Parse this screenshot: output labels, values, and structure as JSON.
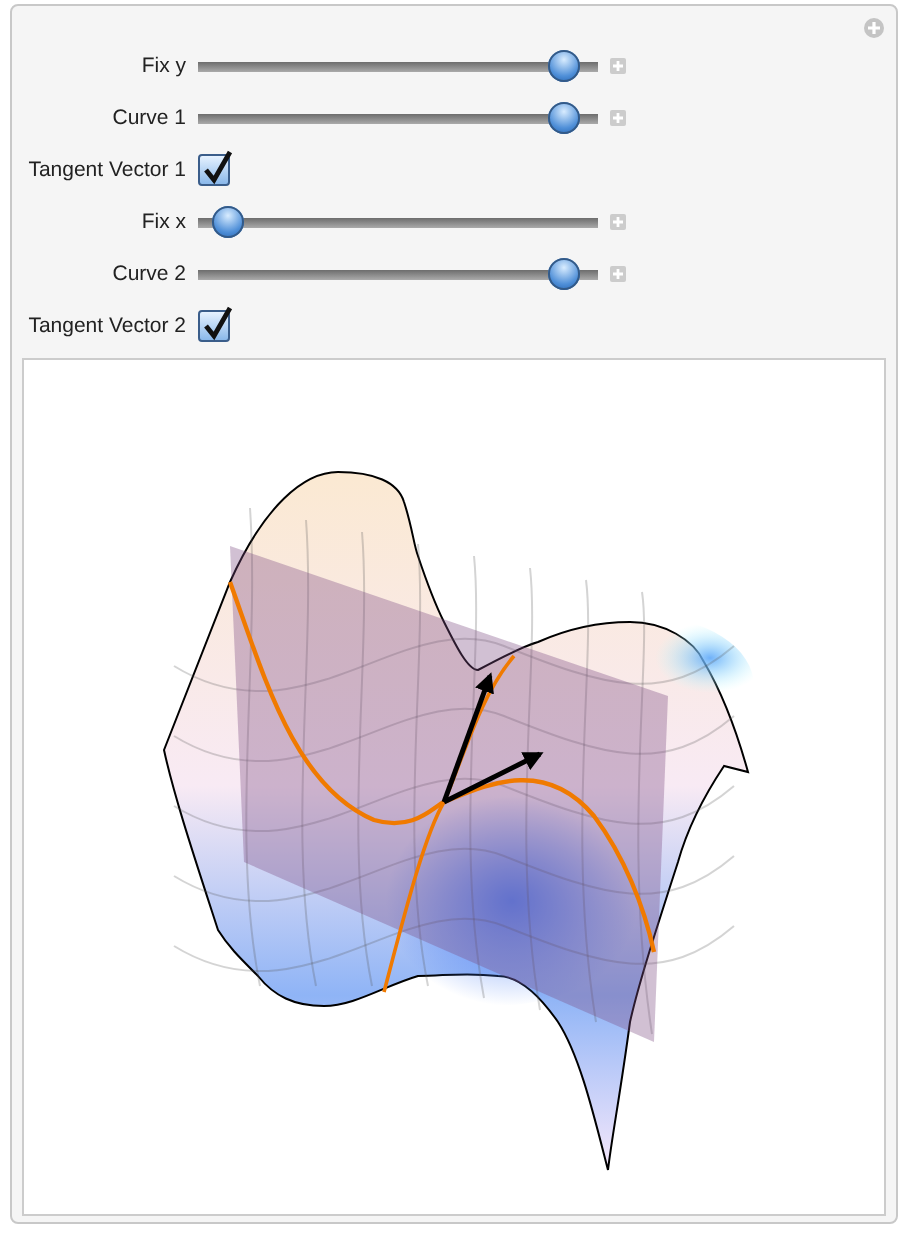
{
  "controls": [
    {
      "kind": "slider",
      "label": "Fix y",
      "level": 0.95
    },
    {
      "kind": "slider",
      "label": "Curve 1",
      "level": 0.95
    },
    {
      "kind": "checkbox",
      "label": "Tangent Vector 1",
      "checked": true
    },
    {
      "kind": "slider",
      "label": "Fix x",
      "level": 0.04
    },
    {
      "kind": "slider",
      "label": "Curve 2",
      "level": 0.95
    },
    {
      "kind": "checkbox",
      "label": "Tangent Vector 2",
      "checked": true
    }
  ]
}
